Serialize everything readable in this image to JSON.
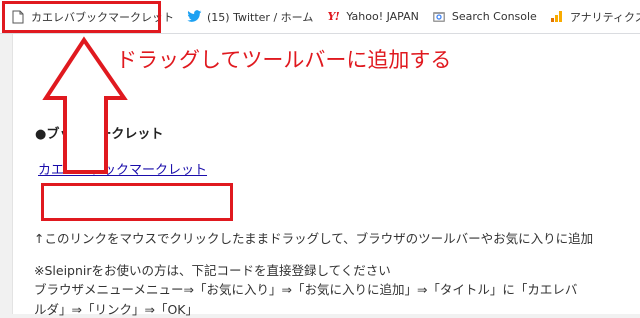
{
  "bookmarks": [
    {
      "label": "カエレバブックマークレット",
      "icon": "page-icon"
    },
    {
      "label": "(15) Twitter / ホーム",
      "icon": "twitter-bird-icon"
    },
    {
      "label": "Yahoo! JAPAN",
      "icon": "yahoo-y-icon",
      "icon_text": "Y!"
    },
    {
      "label": "Search Console",
      "icon": "search-console-icon"
    },
    {
      "label": "アナリティクス",
      "icon": "analytics-icon"
    }
  ],
  "annotation": {
    "heading": "ドラッグしてツールバーに追加する",
    "color": "#e0191f"
  },
  "content": {
    "section_title": "●ブックマークレット",
    "bookmarklet_link": "カエレバブックマークレット",
    "line1": "↑このリンクをマウスでクリックしたままドラッグして、ブラウザのツールバーやお気に入りに追加",
    "line2": "※Sleipnirをお使いの方は、下記コードを直接登録してください",
    "line3": "ブラウザメニューメニュー⇒「お気に入り」⇒「お気に入りに追加」⇒「タイトル」に「カエレバ",
    "line4": "ルダ」⇒「リンク」⇒「OK」"
  },
  "colors": {
    "highlight": "#e0191f",
    "link": "#1a0dab",
    "twitter": "#1da1f2"
  }
}
